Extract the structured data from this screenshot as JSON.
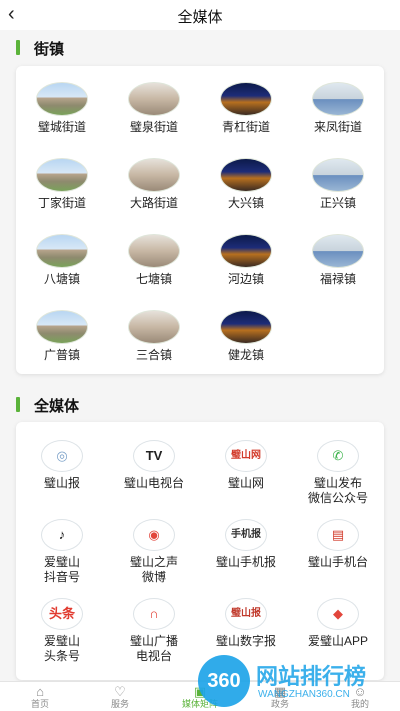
{
  "header": {
    "back_icon": "‹",
    "title": "全媒体"
  },
  "streets": {
    "section_title": "街镇",
    "items": [
      {
        "label": "璧城街道",
        "style": "day"
      },
      {
        "label": "璧泉街道",
        "style": "sq"
      },
      {
        "label": "青杠街道",
        "style": "night"
      },
      {
        "label": "来凤街道",
        "style": "flat"
      },
      {
        "label": "丁家街道",
        "style": "day"
      },
      {
        "label": "大路街道",
        "style": "sq"
      },
      {
        "label": "大兴镇",
        "style": "night"
      },
      {
        "label": "正兴镇",
        "style": "flat"
      },
      {
        "label": "八塘镇",
        "style": "day"
      },
      {
        "label": "七塘镇",
        "style": "sq"
      },
      {
        "label": "河边镇",
        "style": "night"
      },
      {
        "label": "福禄镇",
        "style": "flat"
      },
      {
        "label": "广普镇",
        "style": "day"
      },
      {
        "label": "三合镇",
        "style": "sq"
      },
      {
        "label": "健龙镇",
        "style": "night"
      }
    ]
  },
  "media": {
    "section_title": "全媒体",
    "items": [
      {
        "line1": "璧山报",
        "line2": "",
        "glyph": "◎",
        "color": "#7aa0c8",
        "icon": "newspaper-icon"
      },
      {
        "line1": "璧山电视台",
        "line2": "",
        "glyph": "TV",
        "color": "#222222",
        "icon": "tv-icon"
      },
      {
        "line1": "璧山网",
        "line2": "",
        "glyph": "璧山网",
        "color": "#d23a2a",
        "icon": "website-icon"
      },
      {
        "line1": "璧山发布",
        "line2": "微信公众号",
        "glyph": "✆",
        "color": "#3bb34a",
        "icon": "wechat-icon"
      },
      {
        "line1": "爱璧山",
        "line2": "抖音号",
        "glyph": "♪",
        "color": "#111111",
        "icon": "douyin-icon"
      },
      {
        "line1": "璧山之声",
        "line2": "微博",
        "glyph": "◉",
        "color": "#e2463c",
        "icon": "weibo-icon"
      },
      {
        "line1": "璧山手机报",
        "line2": "",
        "glyph": "手机报",
        "color": "#333333",
        "icon": "mobile-paper-icon"
      },
      {
        "line1": "璧山手机台",
        "line2": "",
        "glyph": "▤",
        "color": "#d23a2a",
        "icon": "mobile-tv-icon"
      },
      {
        "line1": "爱璧山",
        "line2": "头条号",
        "glyph": "头条",
        "color": "#e13b30",
        "icon": "toutiao-icon"
      },
      {
        "line1": "璧山广播",
        "line2": "电视台",
        "glyph": "∩",
        "color": "#e13b30",
        "icon": "radio-icon"
      },
      {
        "line1": "璧山数字报",
        "line2": "",
        "glyph": "璧山报",
        "color": "#c0392b",
        "icon": "digital-paper-icon"
      },
      {
        "line1": "爱璧山APP",
        "line2": "",
        "glyph": "◆",
        "color": "#e2463c",
        "icon": "app-icon"
      }
    ]
  },
  "tabbar": {
    "tabs": [
      {
        "label": "首页",
        "glyph": "⌂",
        "icon": "home-icon",
        "active": false
      },
      {
        "label": "服务",
        "glyph": "♡",
        "icon": "service-icon",
        "active": false
      },
      {
        "label": "媒体矩阵",
        "glyph": "▣",
        "icon": "media-icon",
        "active": true
      },
      {
        "label": "政务",
        "glyph": "▦",
        "icon": "government-icon",
        "active": false
      },
      {
        "label": "我的",
        "glyph": "☺",
        "icon": "profile-icon",
        "active": false
      }
    ]
  },
  "watermark": {
    "badge": "360",
    "text": "网站排行榜",
    "sub": "WANGZHAN360.CN",
    "overlay": "ITMOP.COM"
  }
}
